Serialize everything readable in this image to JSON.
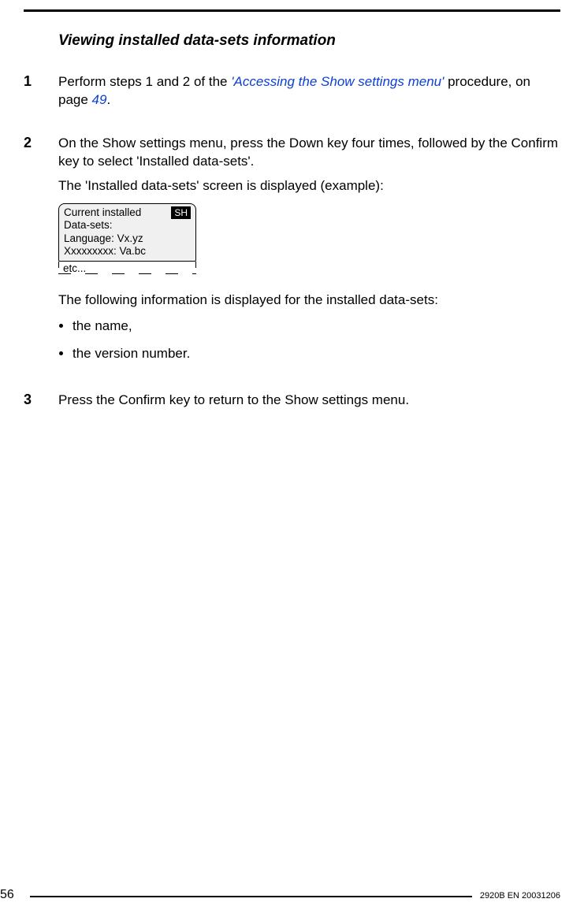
{
  "section_title": "Viewing installed data-sets information",
  "steps": [
    {
      "num": "1",
      "text_before_link": "Perform steps 1 and 2 of the ",
      "link1": "'Accessing the Show settings menu'",
      "text_between": " procedure, on page ",
      "link2": "49",
      "text_after_link": "."
    },
    {
      "num": "2",
      "para1": "On the Show settings menu, press the Down key four times, followed by the Confirm key to select 'Installed data-sets'.",
      "para2": "The 'Installed data-sets' screen is displayed (example):",
      "lcd": {
        "line1": "Current installed",
        "badge": "SH",
        "line2": "Data-sets:",
        "line3": "Language: Vx.yz",
        "line4": "Xxxxxxxxx: Va.bc",
        "line5": "etc..."
      },
      "para3": "The following information is displayed for the installed data-sets:",
      "bullets": [
        "the name,",
        "the version number."
      ]
    },
    {
      "num": "3",
      "para1": "Press the Confirm key to return to the Show settings menu."
    }
  ],
  "footer": {
    "page": "56",
    "doc_id": "2920B EN 20031206"
  }
}
